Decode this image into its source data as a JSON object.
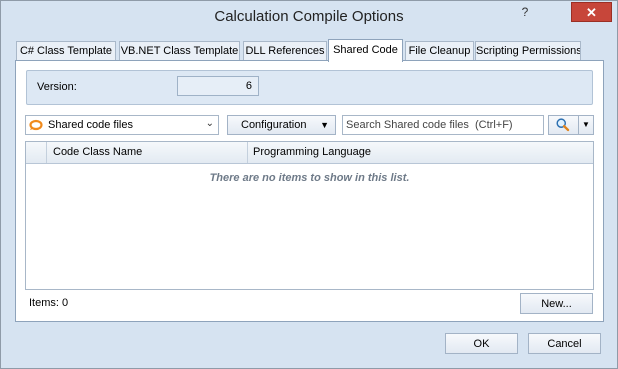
{
  "window": {
    "title": "Calculation Compile Options",
    "help_glyph": "?",
    "close_glyph": "✕"
  },
  "tabs": [
    {
      "label": "C# Class Template",
      "active": false
    },
    {
      "label": "VB.NET Class Template",
      "active": false
    },
    {
      "label": "DLL References",
      "active": false
    },
    {
      "label": "Shared Code",
      "active": true
    },
    {
      "label": "File Cleanup",
      "active": false
    },
    {
      "label": "Scripting Permissions",
      "active": false
    }
  ],
  "version": {
    "label": "Version:",
    "value": "6"
  },
  "toolbar": {
    "scope_selected": "Shared code files",
    "scope_icon": "orange-swirl-icon",
    "configuration_label": "Configuration",
    "search_placeholder": "Search Shared code files  (Ctrl+F)",
    "search_icon": "magnifier-icon"
  },
  "list": {
    "columns": [
      "Code Class Name",
      "Programming Language"
    ],
    "rows": [],
    "empty_message": "There are no items to show in this list."
  },
  "footer": {
    "items_count": "Items: 0",
    "new_label": "New..."
  },
  "dialog_buttons": {
    "ok_label": "OK",
    "cancel_label": "Cancel"
  },
  "colors": {
    "window_bg": "#d6e3f1",
    "close_red": "#c7463a",
    "accent_orange": "#f08a1c"
  }
}
